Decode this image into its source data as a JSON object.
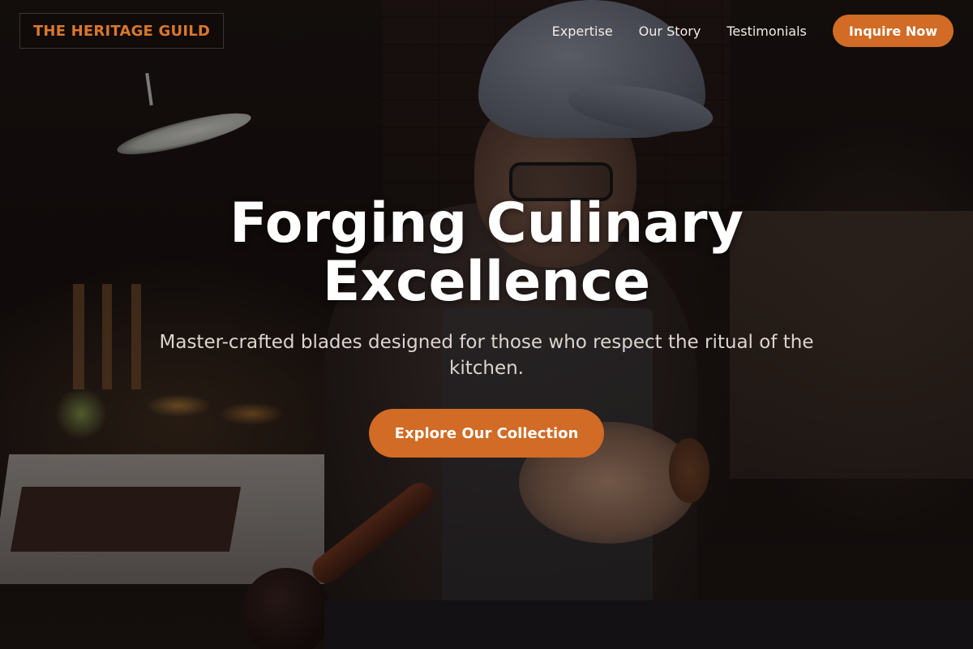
{
  "brand": {
    "name": "THE HERITAGE GUILD",
    "accent_color": "#d16b25"
  },
  "nav": {
    "links": [
      "Expertise",
      "Our Story",
      "Testimonials"
    ],
    "cta_label": "Inquire Now"
  },
  "hero": {
    "title": "Forging Culinary Excellence",
    "subtitle": "Master-crafted blades designed for those who respect the ritual of the kitchen.",
    "cta_label": "Explore Our Collection",
    "background_image": "craftsman-workshop-photo"
  }
}
